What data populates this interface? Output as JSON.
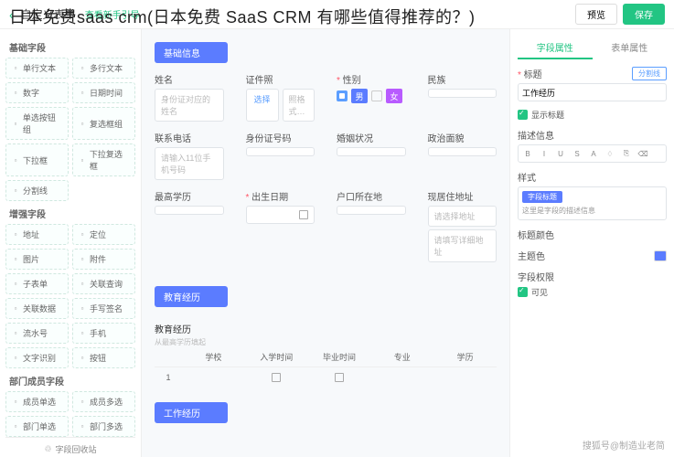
{
  "overlay_title": "日本免费saas crm(日本免费 SaaS CRM 有哪些值得推荐的？)",
  "top": {
    "title": "自定义表单",
    "guide": "查看新手引导",
    "preview": "预览",
    "save": "保存"
  },
  "sidebar": {
    "groups": [
      {
        "title": "基础字段",
        "items": [
          "单行文本",
          "多行文本",
          "数字",
          "日期时间",
          "单选按钮组",
          "复选框组",
          "下拉框",
          "下拉复选框",
          "分割线"
        ]
      },
      {
        "title": "增强字段",
        "items": [
          "地址",
          "定位",
          "图片",
          "附件",
          "子表单",
          "关联查询",
          "关联数据",
          "手写签名",
          "流水号",
          "手机",
          "文字识别",
          "按钮"
        ]
      },
      {
        "title": "部门成员字段",
        "items": [
          "成员单选",
          "成员多选",
          "部门单选",
          "部门多选"
        ]
      }
    ],
    "recycle": "字段回收站"
  },
  "canvas": {
    "section1": "基础信息",
    "labels": {
      "name": "姓名",
      "cert": "证件照",
      "gender": "性别",
      "nation": "民族",
      "phone": "联系电话",
      "idcard": "身份证号码",
      "marital": "婚姻状况",
      "politics": "政治面貌",
      "edu": "最高学历",
      "birth": "出生日期",
      "huji": "户口所在地",
      "live": "现居住地址"
    },
    "placeholders": {
      "name": "身份证对应的姓名",
      "cert_btn": "选择",
      "cert_hint": "照格式…",
      "phone": "请输入11位手机号码",
      "addr": "请选择地址",
      "addr_detail": "请填写详细地址"
    },
    "gender": {
      "m": "男",
      "f": "女"
    },
    "section2": "教育经历",
    "edu_title": "教育经历",
    "edu_hint": "从最高学历填起",
    "table": {
      "cols": [
        "",
        "学校",
        "入学时间",
        "毕业时间",
        "专业",
        "学历"
      ],
      "row1_idx": "1"
    },
    "section3": "工作经历"
  },
  "props": {
    "tabs": [
      "字段属性",
      "表单属性"
    ],
    "title_label": "标题",
    "title_value": "工作经历",
    "divider_btn": "分割线",
    "show_title": "显示标题",
    "desc_label": "描述信息",
    "style_label": "样式",
    "style_tag": "字段标题",
    "style_desc": "这里是字段的描述信息",
    "title_color": "标题颜色",
    "theme_color": "主题色",
    "perm_label": "字段权限",
    "perm_visible": "可见"
  },
  "watermark": "搜狐号@制造业老简"
}
